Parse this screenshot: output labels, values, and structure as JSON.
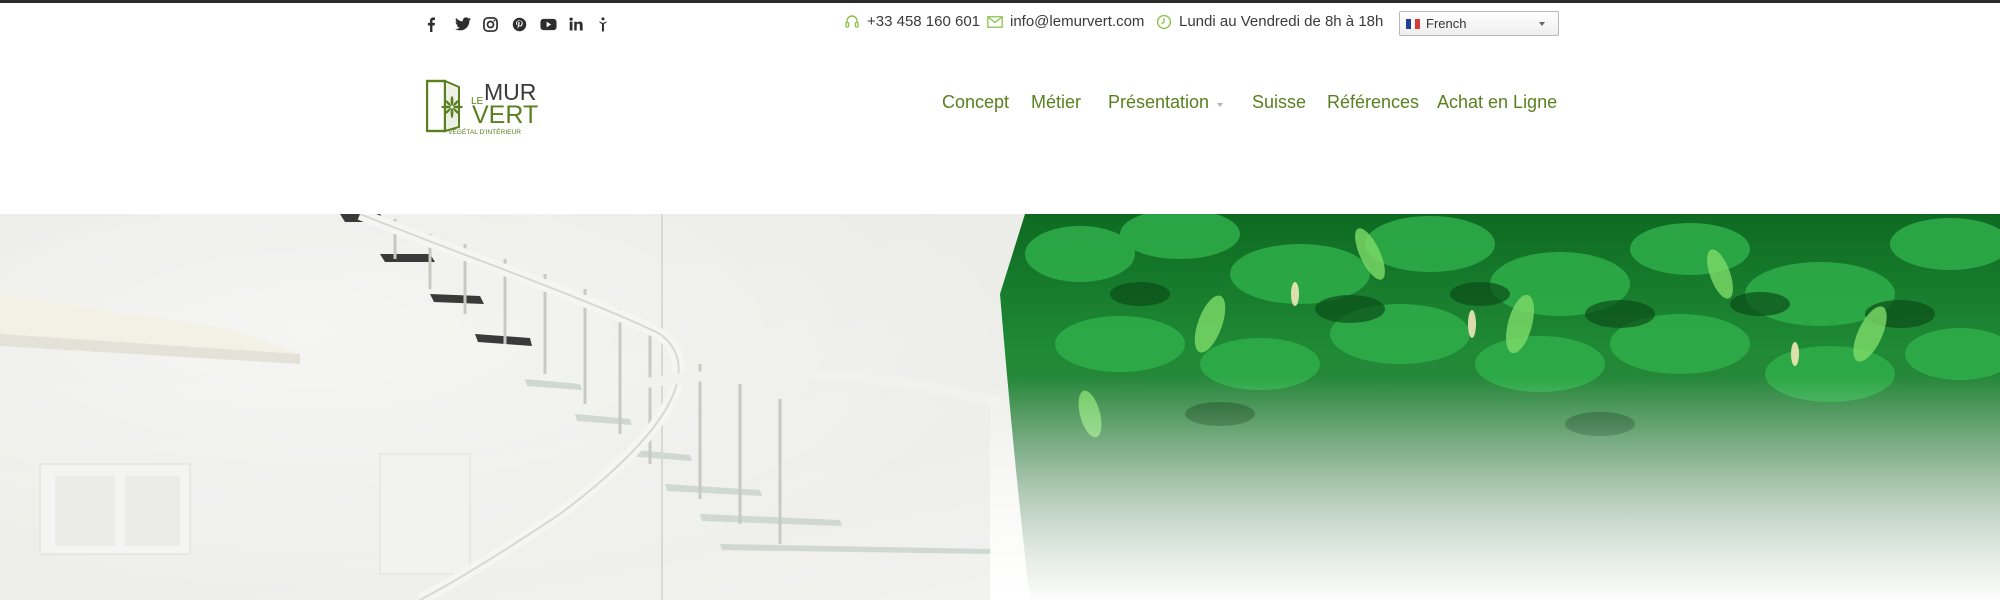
{
  "social": {
    "items": [
      {
        "icon": "facebook-icon"
      },
      {
        "icon": "twitter-icon"
      },
      {
        "icon": "instagram-icon"
      },
      {
        "icon": "pinterest-icon"
      },
      {
        "icon": "youtube-icon"
      },
      {
        "icon": "linkedin-icon"
      },
      {
        "icon": "fashion-icon"
      }
    ],
    "color": "#2d2d2d"
  },
  "contact": {
    "phone": "+33 458 160 601",
    "email": "info@lemurvert.com",
    "hours": "Lundi au Vendredi de 8h à 18h",
    "icon_color": "#8cc34b"
  },
  "language": {
    "selected": "French"
  },
  "logo": {
    "line1_small": "LE",
    "line1": "MUR",
    "line2": "VERT",
    "tagline": "VÉGÉTAL D'INTÉRIEUR"
  },
  "nav": {
    "items": [
      {
        "label": "Concept"
      },
      {
        "label": "Métier"
      },
      {
        "label": "Présentation"
      },
      {
        "label": "Suisse"
      },
      {
        "label": "Références"
      },
      {
        "label": "Achat en Ligne"
      }
    ],
    "color": "#5a7f1f"
  },
  "hero": {
    "description": "staircase-and-vertical-garden-banner"
  }
}
